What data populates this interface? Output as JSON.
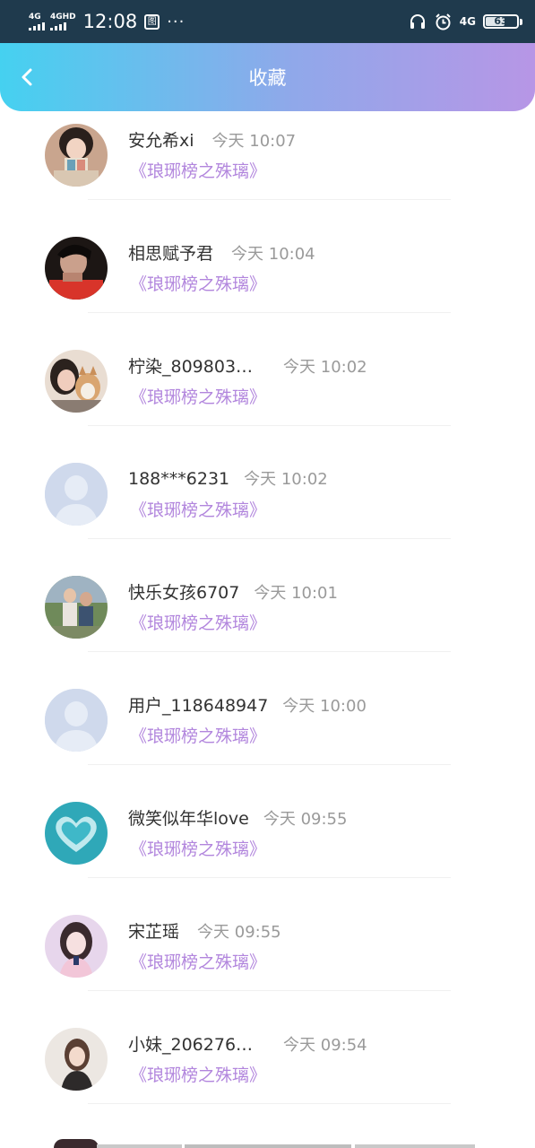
{
  "status_bar": {
    "net1": "4G",
    "net2": "4GHD",
    "time": "12:08",
    "box_glyph": "图",
    "dots": "···",
    "net3": "4G",
    "battery": "63"
  },
  "header": {
    "title": "收藏",
    "back_icon": "chevron-left-icon",
    "gradient_start": "#45d1f0",
    "gradient_end": "#b796e6"
  },
  "colors": {
    "name": "#333333",
    "time": "#9a9a9a",
    "book": "#b286dd"
  },
  "items": [
    {
      "name": "安允希xi",
      "time": "今天 10:07",
      "book": "《琅琊榜之殊璃》",
      "avatar": "photo"
    },
    {
      "name": "相思赋予君",
      "time": "今天 10:04",
      "book": "《琅琊榜之殊璃》",
      "avatar": "photo"
    },
    {
      "name": "柠染_809803…",
      "time": "今天 10:02",
      "book": "《琅琊榜之殊璃》",
      "avatar": "photo"
    },
    {
      "name": "188***6231",
      "time": "今天 10:02",
      "book": "《琅琊榜之殊璃》",
      "avatar": "default"
    },
    {
      "name": "快乐女孩6707",
      "time": "今天 10:01",
      "book": "《琅琊榜之殊璃》",
      "avatar": "photo"
    },
    {
      "name": "用户_118648947",
      "time": "今天 10:00",
      "book": "《琅琊榜之殊璃》",
      "avatar": "default"
    },
    {
      "name": "微笑似年华love",
      "time": "今天 09:55",
      "book": "《琅琊榜之殊璃》",
      "avatar": "photo"
    },
    {
      "name": "宋芷瑶",
      "time": "今天 09:55",
      "book": "《琅琊榜之殊璃》",
      "avatar": "photo"
    },
    {
      "name": "小妹_206276…",
      "time": "今天 09:54",
      "book": "《琅琊榜之殊璃》",
      "avatar": "photo"
    }
  ]
}
